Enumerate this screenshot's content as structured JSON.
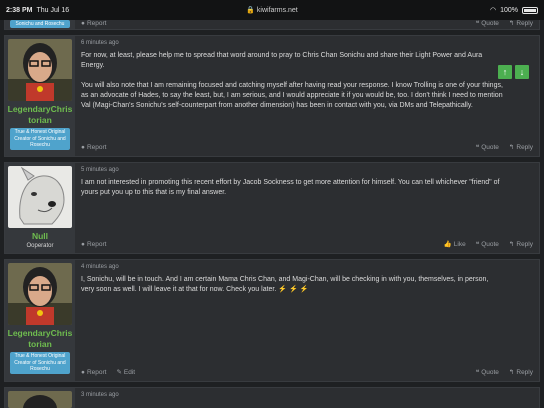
{
  "status": {
    "time": "2:38 PM",
    "date": "Thu Jul 16",
    "url": "kiwifarms.net",
    "battery": "100%"
  },
  "top_partial": {
    "report": "Report",
    "quote": "Quote",
    "reply": "Reply",
    "banner": "Sonichu and Rosechu"
  },
  "posts": [
    {
      "user": "LegendaryChristorian",
      "banner": "True & Honest Original Creator of Sonichu and Rosechu",
      "time": "6 minutes ago",
      "p1": "For now, at least, please help me to spread that word around to pray to Chris Chan Sonichu and share their Light Power and Aura Energy.",
      "p2": "You will also note that I am remaining focused and catching myself after having read your response. I know Trolling is one of your things, as an advocate of Hades, to say the least, but, I am serious, and I would appreciate it if you would be, too. I don't think I need to mention Val (Magi-Chan's Sonichu's self-counterpart from another dimension) has been in contact with you, via DMs and Telepathically.",
      "report": "Report",
      "quote": "Quote",
      "reply": "Reply"
    },
    {
      "user": "Null",
      "title": "Ooperator",
      "time": "5 minutes ago",
      "p1": "I am not interested in promoting this recent effort by Jacob Sockness to get more attention for himself. You can tell whichever \"friend\" of yours put you up to this that is my final answer.",
      "report": "Report",
      "like": "Like",
      "quote": "Quote",
      "reply": "Reply"
    },
    {
      "user": "LegendaryChristorian",
      "banner": "True & Honest Original Creator of Sonichu and Rosechu",
      "time": "4 minutes ago",
      "p1": "I, Sonichu, will be in touch. And I am certain Mama Chris Chan, and Magi-Chan, will be checking in with you, themselves, in person, very soon as well. I will leave it at that for now. Check you later.",
      "emoji": "⚡ ⚡ ⚡",
      "report": "Report",
      "edit": "Edit",
      "quote": "Quote",
      "reply": "Reply"
    },
    {
      "time": "3 minutes ago"
    }
  ]
}
